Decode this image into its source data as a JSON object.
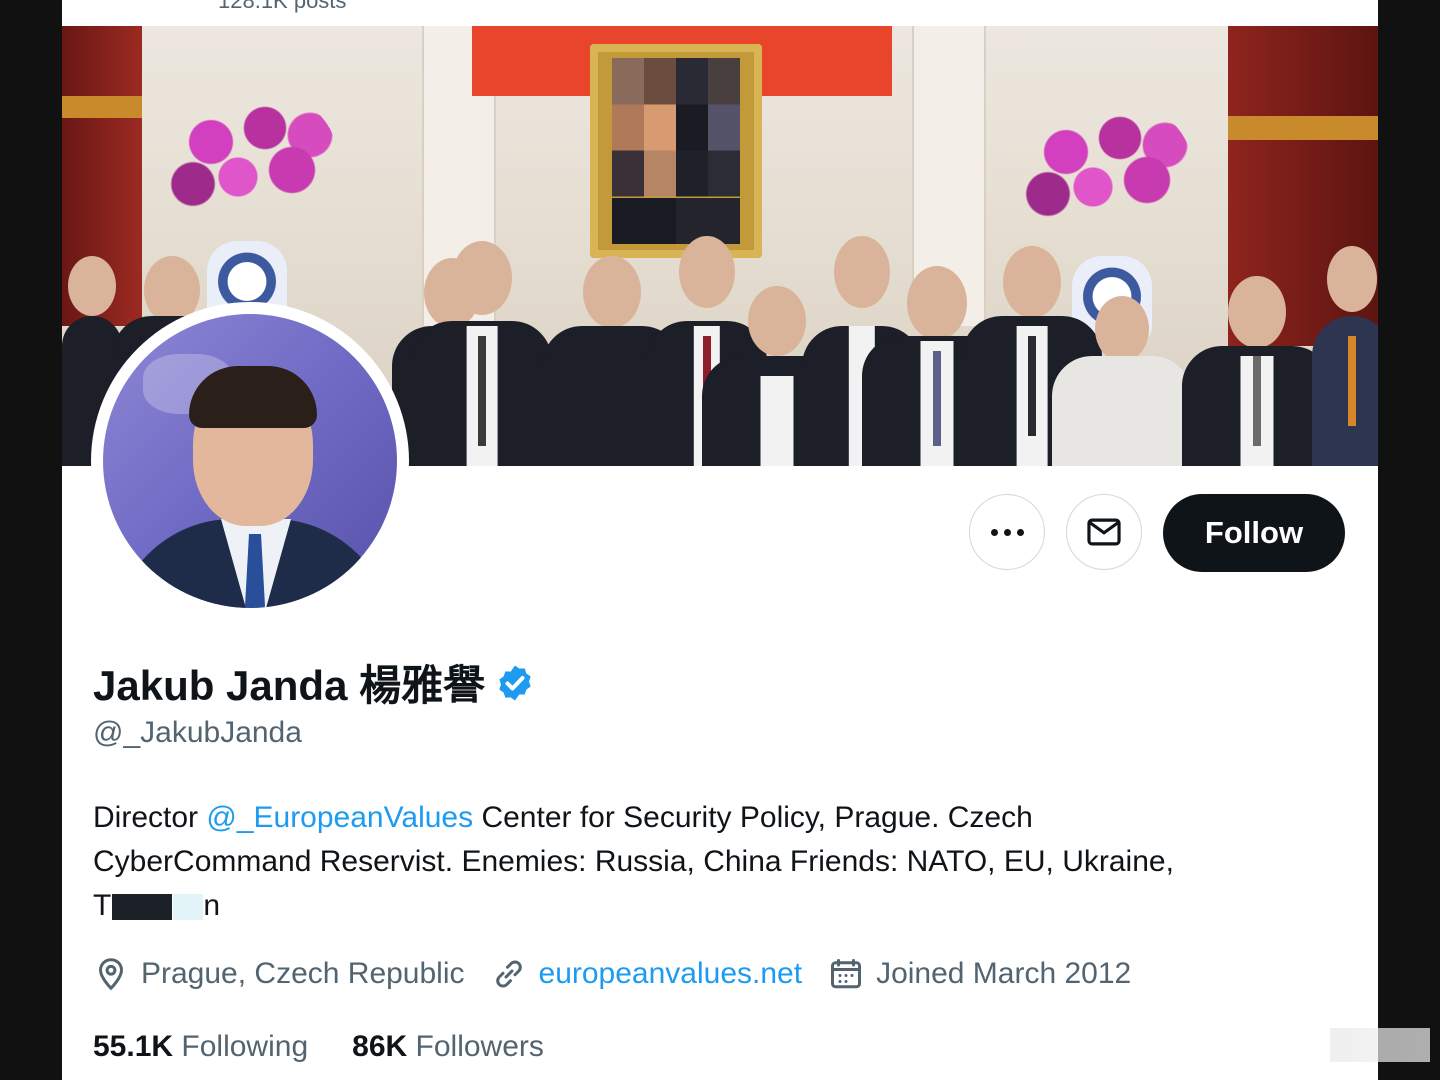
{
  "header": {
    "posts_count": "128.1K posts"
  },
  "banner": {
    "description_alt": ""
  },
  "actions": {
    "more_icon": "more-horizontal-icon",
    "message_icon": "envelope-icon",
    "follow_label": "Follow"
  },
  "profile": {
    "display_name": "Jakub Janda 楊雅譽",
    "verified_icon": "verified-badge-icon",
    "handle": "@_JakubJanda",
    "bio": {
      "prefix": "Director ",
      "mention": "@_EuropeanValues",
      "text_line1_rest": " Center for Security Policy, Prague. Czech",
      "text_line2": "CyberCommand Reservist. Enemies: Russia, China Friends: NATO, EU, Ukraine,",
      "text_line3_start": "T",
      "text_line3_end": "n"
    },
    "location": "Prague, Czech Republic",
    "website": "europeanvalues.net",
    "joined": "Joined March 2012",
    "icons": {
      "location": "location-pin-icon",
      "link": "link-icon",
      "calendar": "calendar-icon"
    },
    "following_count": "55.1K",
    "following_label": "Following",
    "followers_count": "86K",
    "followers_label": "Followers"
  },
  "colors": {
    "accent": "#1d9bf0",
    "text_primary": "#0f1419",
    "text_secondary": "#536471",
    "follow_bg": "#0f1419"
  }
}
